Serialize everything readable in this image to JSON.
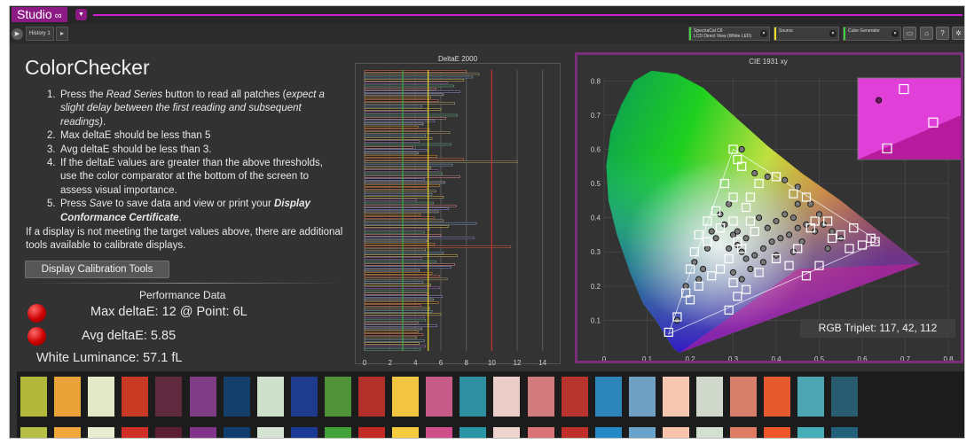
{
  "app": {
    "name": "Studio",
    "tab": "History 1"
  },
  "toolbar": {
    "meter_line1": "SpectraCal C6",
    "meter_line2": "LCD Direct View (White LED)",
    "source": "Source",
    "generator": "Cube Generator",
    "meter_stripe": "#3fd33f",
    "source_stripe": "#f0e020",
    "generator_stripe": "#3fd33f"
  },
  "page": {
    "title": "ColorChecker",
    "steps": [
      {
        "num": "1.",
        "a": "Press the ",
        "em": "Read Series",
        "b": " button to read all patches (",
        "em2": "expect a slight delay between the first reading and subsequent readings)",
        "c": "."
      },
      {
        "num": "2.",
        "text": "Max deltaE should be less than 5"
      },
      {
        "num": "3.",
        "text": "Avg deltaE should be less than 3."
      },
      {
        "num": "4.",
        "text": "If the deltaE values are greater than the above thresholds, use the color comparator at the bottom of the screen to assess visual importance."
      },
      {
        "num": "5.",
        "a": "Press ",
        "em": "Save",
        "b": " to save data and view or print your ",
        "strong": "Display Conformance Certificate",
        "c": "."
      }
    ],
    "note": "If a display is not meeting the target values above, there are additional tools available to calibrate displays.",
    "tools_button": "Display Calibration Tools"
  },
  "performance": {
    "title": "Performance Data",
    "max": "Max deltaE: 12   @ Point: 6L",
    "avg": "Avg deltaE: 5.85",
    "white": "White Luminance: 57.1 fL"
  },
  "chart_data": [
    {
      "type": "bar",
      "orientation": "horizontal",
      "title": "DeltaE 2000",
      "xlim": [
        0,
        15
      ],
      "xticks": [
        0,
        2,
        4,
        6,
        8,
        10,
        12,
        14
      ],
      "threshold_lines": [
        {
          "value": 3,
          "color": "#3fa93f"
        },
        {
          "value": 5,
          "color": "#e8d42a"
        },
        {
          "value": 10,
          "color": "#c83030"
        }
      ],
      "values": [
        8,
        9,
        8.5,
        7.8,
        6.5,
        7,
        5.6,
        7.5,
        6.2,
        5.2,
        5.8,
        7.1,
        4.5,
        6,
        5,
        7.3,
        6.4,
        5.5,
        4.6,
        4.2,
        5.1,
        6.7,
        4.8,
        5.3,
        4.3,
        6.8,
        3.8,
        4.9,
        4.2,
        5.7,
        7.8,
        12,
        6.9,
        5.2,
        5.8,
        6.1,
        7.5,
        4.7,
        6.3,
        5.9,
        4.9,
        5.6,
        5.3,
        6.2,
        4.1,
        5.4,
        7.2,
        6.6,
        5.8,
        4.4,
        5.5,
        6.2,
        8.8,
        6.6,
        5.1,
        4.7,
        6.0,
        8.6,
        4.9,
        5.5,
        11.5,
        4.8,
        6.2,
        7.3,
        4.5,
        5.6,
        7.1,
        6.8,
        4.3,
        5.3,
        5.9,
        6.5,
        4.6,
        5.2,
        5.9,
        5.0,
        4.9,
        6.1,
        5.4,
        5.8,
        4.4,
        5.1,
        5.3,
        6.0,
        4.7,
        4.8,
        4.2,
        5.7,
        4.5,
        4.2,
        4.6,
        4.1,
        4.7,
        4.3,
        4.8,
        4.4
      ]
    },
    {
      "type": "scatter",
      "title": "CIE 1931 xy",
      "xlim": [
        0,
        0.8
      ],
      "ylim": [
        0,
        0.85
      ],
      "xticks": [
        0,
        0.1,
        0.2,
        0.3,
        0.4,
        0.5,
        0.6,
        0.7,
        0.8
      ],
      "yticks": [
        0.1,
        0.2,
        0.3,
        0.4,
        0.5,
        0.6,
        0.7,
        0.8
      ],
      "gamut_triangle": [
        [
          0.64,
          0.33
        ],
        [
          0.3,
          0.6
        ],
        [
          0.15,
          0.06
        ]
      ],
      "target_points": [
        [
          0.15,
          0.065
        ],
        [
          0.17,
          0.11
        ],
        [
          0.19,
          0.18
        ],
        [
          0.2,
          0.25
        ],
        [
          0.21,
          0.3
        ],
        [
          0.22,
          0.35
        ],
        [
          0.24,
          0.39
        ],
        [
          0.26,
          0.42
        ],
        [
          0.28,
          0.5
        ],
        [
          0.3,
          0.6
        ],
        [
          0.31,
          0.57
        ],
        [
          0.32,
          0.55
        ],
        [
          0.3,
          0.46
        ],
        [
          0.33,
          0.43
        ],
        [
          0.34,
          0.39
        ],
        [
          0.35,
          0.36
        ],
        [
          0.31,
          0.33
        ],
        [
          0.32,
          0.31
        ],
        [
          0.29,
          0.28
        ],
        [
          0.27,
          0.25
        ],
        [
          0.25,
          0.23
        ],
        [
          0.22,
          0.2
        ],
        [
          0.2,
          0.16
        ],
        [
          0.3,
          0.21
        ],
        [
          0.31,
          0.17
        ],
        [
          0.33,
          0.19
        ],
        [
          0.29,
          0.13
        ],
        [
          0.36,
          0.24
        ],
        [
          0.4,
          0.28
        ],
        [
          0.43,
          0.26
        ],
        [
          0.47,
          0.23
        ],
        [
          0.5,
          0.26
        ],
        [
          0.45,
          0.31
        ],
        [
          0.48,
          0.37
        ],
        [
          0.52,
          0.39
        ],
        [
          0.55,
          0.35
        ],
        [
          0.58,
          0.37
        ],
        [
          0.6,
          0.32
        ],
        [
          0.63,
          0.33
        ],
        [
          0.62,
          0.34
        ],
        [
          0.57,
          0.31
        ],
        [
          0.53,
          0.34
        ],
        [
          0.49,
          0.39
        ],
        [
          0.47,
          0.46
        ],
        [
          0.44,
          0.47
        ],
        [
          0.4,
          0.52
        ],
        [
          0.36,
          0.5
        ],
        [
          0.34,
          0.46
        ],
        [
          0.3,
          0.39
        ],
        [
          0.27,
          0.37
        ],
        [
          0.24,
          0.33
        ]
      ],
      "measured_points": [
        [
          0.17,
          0.1
        ],
        [
          0.19,
          0.2
        ],
        [
          0.21,
          0.27
        ],
        [
          0.24,
          0.31
        ],
        [
          0.26,
          0.34
        ],
        [
          0.28,
          0.38
        ],
        [
          0.3,
          0.35
        ],
        [
          0.31,
          0.32
        ],
        [
          0.32,
          0.3
        ],
        [
          0.33,
          0.28
        ],
        [
          0.35,
          0.29
        ],
        [
          0.37,
          0.31
        ],
        [
          0.39,
          0.33
        ],
        [
          0.41,
          0.34
        ],
        [
          0.43,
          0.35
        ],
        [
          0.45,
          0.37
        ],
        [
          0.47,
          0.38
        ],
        [
          0.49,
          0.36
        ],
        [
          0.51,
          0.38
        ],
        [
          0.53,
          0.36
        ],
        [
          0.55,
          0.34
        ],
        [
          0.5,
          0.41
        ],
        [
          0.48,
          0.44
        ],
        [
          0.45,
          0.49
        ],
        [
          0.42,
          0.51
        ],
        [
          0.38,
          0.52
        ],
        [
          0.35,
          0.53
        ],
        [
          0.32,
          0.6
        ],
        [
          0.29,
          0.44
        ],
        [
          0.27,
          0.41
        ],
        [
          0.25,
          0.36
        ],
        [
          0.23,
          0.25
        ],
        [
          0.22,
          0.22
        ],
        [
          0.3,
          0.24
        ],
        [
          0.32,
          0.22
        ],
        [
          0.34,
          0.25
        ],
        [
          0.37,
          0.27
        ],
        [
          0.4,
          0.29
        ],
        [
          0.44,
          0.3
        ],
        [
          0.46,
          0.33
        ],
        [
          0.52,
          0.31
        ],
        [
          0.29,
          0.31
        ],
        [
          0.31,
          0.36
        ],
        [
          0.36,
          0.4
        ],
        [
          0.4,
          0.39
        ],
        [
          0.42,
          0.41
        ],
        [
          0.45,
          0.44
        ],
        [
          0.44,
          0.4
        ],
        [
          0.38,
          0.37
        ],
        [
          0.33,
          0.34
        ]
      ],
      "inset": {
        "fill": "#e040d8",
        "target_points": [
          [
            0.66,
            0.79
          ],
          [
            0.73,
            0.7
          ],
          [
            0.62,
            0.63
          ]
        ],
        "measured_points": [
          [
            0.6,
            0.76
          ]
        ]
      }
    }
  ],
  "rgb_triplet": "RGB Triplet: 117, 42, 112",
  "swatches": {
    "top": [
      "#b2b83a",
      "#eaa338",
      "#e3e8c8",
      "#c93a25",
      "#5f2a3d",
      "#7d3c84",
      "#143f6a",
      "#cfe0cc",
      "#1f3b8c",
      "#4f9238",
      "#b32f2a",
      "#f2c541",
      "#c55b86",
      "#2e8fa0",
      "#ebcdc9",
      "#d17b7f",
      "#b8352f",
      "#2c86bb",
      "#6f9fc2",
      "#f6c7b0",
      "#cfd8cb",
      "#d87f6c",
      "#e75a2f",
      "#4ea6b3",
      "#2a5c71"
    ],
    "bottom": [
      "#b5c046",
      "#f0a63a",
      "#e8ecd0",
      "#d02f28",
      "#5a1f33",
      "#80358a",
      "#0f3d6e",
      "#d6e5d3",
      "#1a3a94",
      "#43a13a",
      "#c22a26",
      "#f5cb40",
      "#cd4e8a",
      "#2996a8",
      "#efd3cf",
      "#d97479",
      "#c02f2c",
      "#2489c4",
      "#6aa2cb",
      "#f7c4ab",
      "#d3dfd0",
      "#df7c66",
      "#ee5529",
      "#46aeb9",
      "#22617a"
    ]
  }
}
